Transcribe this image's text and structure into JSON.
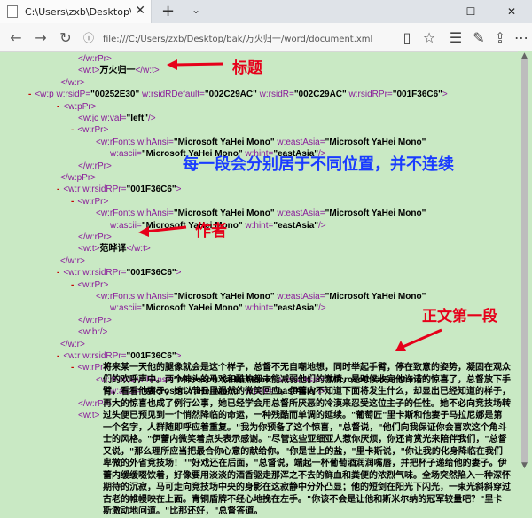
{
  "browser": {
    "tab_title": "C:\\Users\\zxb\\Desktop\\b",
    "tab_close": "✕",
    "new_tab": "+",
    "url": "file:///C:/Users/zxb/Desktop/bak/万火归一/word/document.xml",
    "window": {
      "minimize": "—",
      "maximize": "☐",
      "close": "✕"
    }
  },
  "xml_lines": [
    {
      "indent": 88,
      "parts": [
        {
          "c": "tag",
          "t": "</w:rPr>"
        }
      ]
    },
    {
      "indent": 88,
      "parts": [
        {
          "c": "tag",
          "t": "<w:t>"
        },
        {
          "c": "txt",
          "t": "万火归一"
        },
        {
          "c": "tag",
          "t": "</w:t>"
        }
      ]
    },
    {
      "indent": 68,
      "parts": [
        {
          "c": "tag",
          "t": "</w:r>"
        }
      ]
    },
    {
      "indent": 32,
      "minus": true,
      "parts": [
        {
          "c": "tag",
          "t": "<w:p "
        },
        {
          "c": "attr",
          "t": "w:rsidP="
        },
        {
          "c": "val",
          "t": "\"00252E30\""
        },
        {
          "c": "attr",
          "t": " w:rsidRDefault="
        },
        {
          "c": "val",
          "t": "\"002C29AC\""
        },
        {
          "c": "attr",
          "t": " w:rsidR="
        },
        {
          "c": "val",
          "t": "\"002C29AC\""
        },
        {
          "c": "attr",
          "t": " w:rsidRPr="
        },
        {
          "c": "val",
          "t": "\"001F36C6\""
        },
        {
          "c": "tag",
          "t": ">"
        }
      ]
    },
    {
      "indent": 64,
      "minus": true,
      "parts": [
        {
          "c": "tag",
          "t": "<w:pPr>"
        }
      ]
    },
    {
      "indent": 88,
      "parts": [
        {
          "c": "tag",
          "t": "<w:jc "
        },
        {
          "c": "attr",
          "t": "w:val="
        },
        {
          "c": "val",
          "t": "\"left\""
        },
        {
          "c": "tag",
          "t": "/>"
        }
      ]
    },
    {
      "indent": 80,
      "minus": true,
      "parts": [
        {
          "c": "tag",
          "t": "<w:rPr>"
        }
      ]
    },
    {
      "indent": 108,
      "parts": [
        {
          "c": "tag",
          "t": "<w:rFonts "
        },
        {
          "c": "attr",
          "t": "w:hAnsi="
        },
        {
          "c": "val",
          "t": "\"Microsoft YaHei Mono\""
        },
        {
          "c": "attr",
          "t": " w:eastAsia="
        },
        {
          "c": "val",
          "t": "\"Microsoft YaHei Mono\""
        }
      ]
    },
    {
      "indent": 124,
      "parts": [
        {
          "c": "attr",
          "t": "w:ascii="
        },
        {
          "c": "val",
          "t": "\"Microsoft YaHei Mono\""
        },
        {
          "c": "attr",
          "t": " w:hint="
        },
        {
          "c": "val",
          "t": "\"eastAsia\""
        },
        {
          "c": "tag",
          "t": "/>"
        }
      ]
    },
    {
      "indent": 88,
      "parts": [
        {
          "c": "tag",
          "t": "</w:rPr>"
        }
      ]
    },
    {
      "indent": 68,
      "parts": [
        {
          "c": "tag",
          "t": "</w:pPr>"
        }
      ]
    },
    {
      "indent": 64,
      "minus": true,
      "parts": [
        {
          "c": "tag",
          "t": "<w:r "
        },
        {
          "c": "attr",
          "t": "w:rsidRPr="
        },
        {
          "c": "val",
          "t": "\"001F36C6\""
        },
        {
          "c": "tag",
          "t": ">"
        }
      ]
    },
    {
      "indent": 80,
      "minus": true,
      "parts": [
        {
          "c": "tag",
          "t": "<w:rPr>"
        }
      ]
    },
    {
      "indent": 108,
      "parts": [
        {
          "c": "tag",
          "t": "<w:rFonts "
        },
        {
          "c": "attr",
          "t": "w:hAnsi="
        },
        {
          "c": "val",
          "t": "\"Microsoft YaHei Mono\""
        },
        {
          "c": "attr",
          "t": " w:eastAsia="
        },
        {
          "c": "val",
          "t": "\"Microsoft YaHei Mono\""
        }
      ]
    },
    {
      "indent": 124,
      "parts": [
        {
          "c": "attr",
          "t": "w:ascii="
        },
        {
          "c": "val",
          "t": "\"Microsoft YaHei Mono\""
        },
        {
          "c": "attr",
          "t": " w:hint="
        },
        {
          "c": "val",
          "t": "\"eastAsia\""
        },
        {
          "c": "tag",
          "t": "/>"
        }
      ]
    },
    {
      "indent": 88,
      "parts": [
        {
          "c": "tag",
          "t": "</w:rPr>"
        }
      ]
    },
    {
      "indent": 88,
      "parts": [
        {
          "c": "tag",
          "t": "<w:t>"
        },
        {
          "c": "txt",
          "t": "范晔译"
        },
        {
          "c": "tag",
          "t": "</w:t>"
        }
      ]
    },
    {
      "indent": 68,
      "parts": [
        {
          "c": "tag",
          "t": "</w:r>"
        }
      ]
    },
    {
      "indent": 64,
      "minus": true,
      "parts": [
        {
          "c": "tag",
          "t": "<w:r "
        },
        {
          "c": "attr",
          "t": "w:rsidRPr="
        },
        {
          "c": "val",
          "t": "\"001F36C6\""
        },
        {
          "c": "tag",
          "t": ">"
        }
      ]
    },
    {
      "indent": 80,
      "minus": true,
      "parts": [
        {
          "c": "tag",
          "t": "<w:rPr>"
        }
      ]
    },
    {
      "indent": 108,
      "parts": [
        {
          "c": "tag",
          "t": "<w:rFonts "
        },
        {
          "c": "attr",
          "t": "w:hAnsi="
        },
        {
          "c": "val",
          "t": "\"Microsoft YaHei Mono\""
        },
        {
          "c": "attr",
          "t": " w:eastAsia="
        },
        {
          "c": "val",
          "t": "\"Microsoft YaHei Mono\""
        }
      ]
    },
    {
      "indent": 124,
      "parts": [
        {
          "c": "attr",
          "t": "w:ascii="
        },
        {
          "c": "val",
          "t": "\"Microsoft YaHei Mono\""
        },
        {
          "c": "attr",
          "t": " w:hint="
        },
        {
          "c": "val",
          "t": "\"eastAsia\""
        },
        {
          "c": "tag",
          "t": "/>"
        }
      ]
    },
    {
      "indent": 88,
      "parts": [
        {
          "c": "tag",
          "t": "</w:rPr>"
        }
      ]
    },
    {
      "indent": 88,
      "parts": [
        {
          "c": "tag",
          "t": "<w:br/>"
        }
      ]
    },
    {
      "indent": 68,
      "parts": [
        {
          "c": "tag",
          "t": "</w:r>"
        }
      ]
    },
    {
      "indent": 64,
      "minus": true,
      "parts": [
        {
          "c": "tag",
          "t": "<w:r "
        },
        {
          "c": "attr",
          "t": "w:rsidRPr="
        },
        {
          "c": "val",
          "t": "\"001F36C6\""
        },
        {
          "c": "tag",
          "t": ">"
        }
      ]
    },
    {
      "indent": 80,
      "minus": true,
      "parts": [
        {
          "c": "tag",
          "t": "<w:rPr>"
        }
      ]
    },
    {
      "indent": 108,
      "parts": [
        {
          "c": "tag",
          "t": "<w:rFonts "
        },
        {
          "c": "attr",
          "t": "w:hAnsi="
        },
        {
          "c": "val",
          "t": "\"Microsoft YaHei Mono\""
        },
        {
          "c": "attr",
          "t": " w:eastAsia="
        },
        {
          "c": "val",
          "t": "\"Microsoft YaHei Mono\""
        }
      ]
    },
    {
      "indent": 124,
      "parts": [
        {
          "c": "attr",
          "t": "w:ascii="
        },
        {
          "c": "val",
          "t": "\"Microsoft YaHei Mono\""
        },
        {
          "c": "attr",
          "t": " w:hint="
        },
        {
          "c": "val",
          "t": "\"eastAsia\""
        },
        {
          "c": "tag",
          "t": "/>"
        }
      ]
    },
    {
      "indent": 88,
      "parts": [
        {
          "c": "tag",
          "t": "</w:rPr>"
        }
      ]
    },
    {
      "indent": 88,
      "parts": [
        {
          "c": "tag",
          "t": "<w:t>"
        }
      ]
    }
  ],
  "paragraph_text": "将来某一天他的腿像就会是这个样子，总督不无自嘲地想，同时举起手臂，停在致意的姿势，凝固在观众们的欢呼声中。两个神头的马戏和酷热都未能减弱他们的激情，是时候收完他许诺的惊喜了，总督放下手臂，看看他妻子，她以节日里温然的微笑回应。伊蕾内不知道下面将发生什么，却显出已经知道的样子，再大的惊喜也成了例行公事，她已经学会用总督所厌恶的冷漠来忍受这位主子的任性。她不必向竞技场转过头便已预见到一个悄然降临的命运，一种残酷而单调的延续。\"葡萄匠\"里卡斯和他妻子马拉尼娜是第一个名字，人群随即呼应着重复。\"我为你预备了这个惊喜，\"总督说，\"他们向我保证你会喜欢这个角斗士的风格。\"伊蕾内微笑着点头表示感谢。\"尽管这些亚细亚人惹你厌烦，你还肯赏光来陪伴我们，\"总督又说，\"那么理所应当把最合你心意的献给你。\"你是世上的盐，\"里卡斯说，\"你让我的化身降临在我们卑微的外省竞技场！\"\"好戏还在后面，\"总督说，端起一杯葡萄酒润润嘴唇，并把杯子递给他的妻子。伊蕾内缓缓啜饮着，好像要用淡淡的酒香驱走那浑之不去的鲜血和粪便的浓烈气味。全场突然陷入一种深怀期待的沉寂，马可走向竞技场中央的身影在这寂静中分外凸显；他的短剑在阳光下闪光，一束光斜斜穿过古老的帷幔映在上面。青铜盾牌不经心地挽在左手。\"你该不会是让他和斯米尔纳的冠军较量吧？\"里卡斯激动地问道。\"比那还好，\"总督答道。",
  "annotations": {
    "title": "标题",
    "each_paragraph": "每一段会分别居于不同位置，并不连续",
    "author": "作者",
    "first_paragraph": "正文第一段"
  },
  "colors": {
    "annotation_red": "#e6001a",
    "annotation_blue": "#1a3cff",
    "background": "#c9e9c4"
  }
}
